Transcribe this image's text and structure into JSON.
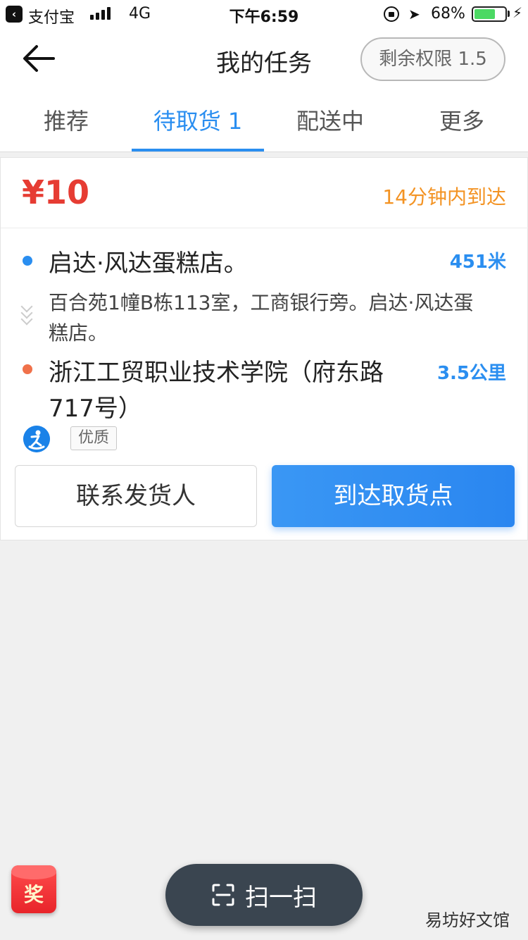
{
  "status_bar": {
    "back_app_glyph": "‹",
    "app": "支付宝",
    "network": "4G",
    "time": "下午6:59",
    "battery_percent": "68%",
    "battery_level": 0.68
  },
  "header": {
    "title": "我的任务",
    "quota": "剩余权限 1.5"
  },
  "tabs": [
    {
      "label": "推荐",
      "active": false
    },
    {
      "label": "待取货 1",
      "active": true
    },
    {
      "label": "配送中",
      "active": false
    },
    {
      "label": "更多",
      "active": false
    }
  ],
  "order": {
    "price": "¥10",
    "eta": "14分钟内到达",
    "pickup": {
      "name": "启达·风达蛋糕店。",
      "distance": "451米",
      "address": "百合苑1幢B栋113室，工商银行旁。启达·风达蛋糕店。"
    },
    "dropoff": {
      "name": "浙江工贸职业技术学院（府东路717号）",
      "distance": "3.5公里"
    },
    "tag": "优质",
    "contact_button": "联系发货人",
    "arrive_button": "到达取货点"
  },
  "bottom": {
    "reward_label": "奖",
    "scan_label": "扫一扫",
    "watermark": "易坊好文馆"
  },
  "colors": {
    "accent": "#2a8ef0",
    "price": "#e63c33",
    "eta": "#f39323",
    "dropoff_dot": "#f0714a"
  }
}
